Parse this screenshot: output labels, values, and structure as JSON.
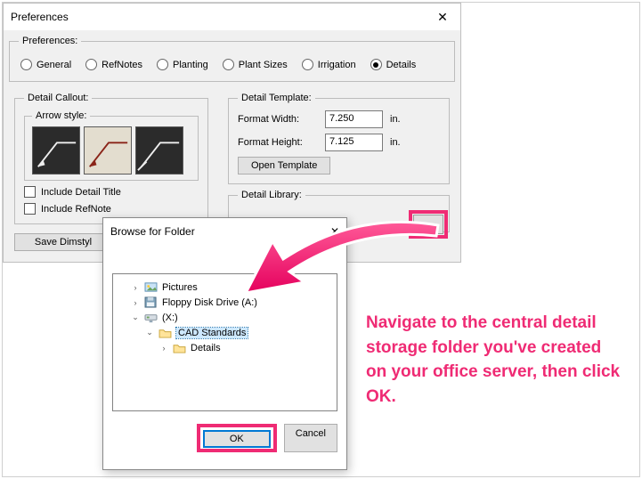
{
  "prefs": {
    "window_title": "Preferences",
    "close_glyph": "✕",
    "group_label": "Preferences:",
    "tabs": {
      "general": "General",
      "refnotes": "RefNotes",
      "planting": "Planting",
      "plant_sizes": "Plant Sizes",
      "irrigation": "Irrigation",
      "details": "Details"
    },
    "callout": {
      "group_label": "Detail Callout:",
      "arrow_label": "Arrow style:",
      "include_title": "Include Detail Title",
      "include_refnote": "Include RefNote"
    },
    "template": {
      "group_label": "Detail Template:",
      "width_label": "Format Width:",
      "width_value": "7.250",
      "height_label": "Format Height:",
      "height_value": "7.125",
      "unit": "in.",
      "open_btn": "Open Template"
    },
    "library": {
      "group_label": "Detail Library:",
      "browse_glyph": "..."
    },
    "save_dim_btn": "Save Dimstyl"
  },
  "browse": {
    "title": "Browse for Folder",
    "close_glyph": "✕",
    "tree": {
      "pictures": "Pictures",
      "floppy": "Floppy Disk Drive (A:)",
      "xdrive": "(X:)",
      "cad": "CAD Standards",
      "details": "Details"
    },
    "ok": "OK",
    "cancel": "Cancel"
  },
  "annotation": {
    "caption": "Navigate to the central detail storage folder you've created on your office server, then click OK."
  }
}
